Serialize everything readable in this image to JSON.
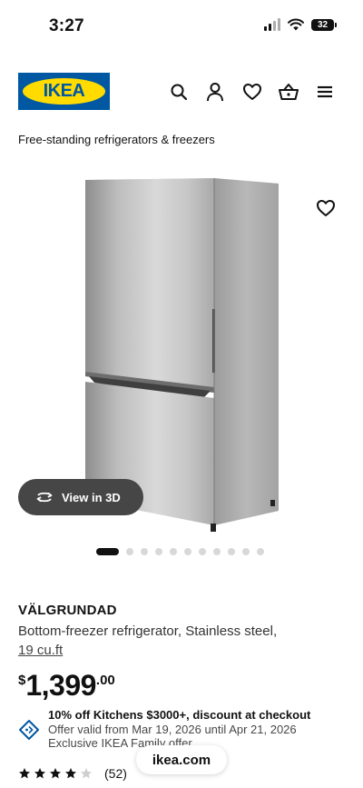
{
  "status_bar": {
    "time": "3:27",
    "battery": "32"
  },
  "brand": {
    "logo_text": "IKEA",
    "blue": "#0058a3",
    "yellow": "#ffdb00"
  },
  "header": {
    "icons": [
      "search-icon",
      "account-icon",
      "heart-icon",
      "basket-icon",
      "menu-icon"
    ]
  },
  "breadcrumb": "Free-standing refrigerators & freezers",
  "gallery": {
    "view_3d_label": "View in 3D",
    "dot_count": 11,
    "active_dot": 0
  },
  "product": {
    "name": "VÄLGRUNDAD",
    "description": "Bottom-freezer refrigerator, Stainless steel,",
    "size_link": "19 cu.ft",
    "currency": "$",
    "price_whole": "1,399",
    "price_cents": ".00"
  },
  "promo": {
    "title": "10% off Kitchens $3000+, discount at checkout",
    "validity": "Offer valid from Mar 19, 2026 until Apr 21, 2026",
    "family": "Exclusive IKEA Family offer"
  },
  "url_pill": "ikea.com",
  "rating": {
    "stars": 4,
    "max": 5,
    "count": "(52)"
  }
}
